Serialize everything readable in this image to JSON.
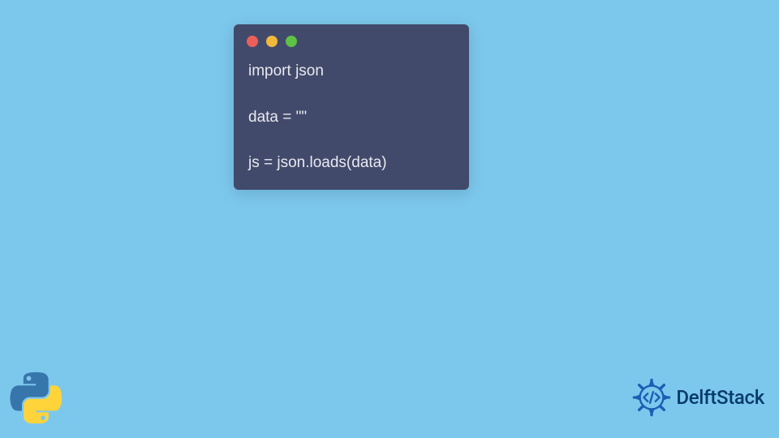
{
  "window": {
    "dots": {
      "red": "#ec5f59",
      "yellow": "#f1b93c",
      "green": "#5ec245"
    }
  },
  "code": {
    "lines": [
      "import json",
      "",
      "data = \"\"",
      "",
      "js = json.loads(data)"
    ]
  },
  "brand": {
    "name": "DelftStack"
  },
  "colors": {
    "background": "#7cc8ed",
    "window_bg": "#424a6b",
    "code_text": "#e8e9ef",
    "brand_text": "#083a6b",
    "python_blue": "#3776ab",
    "python_yellow": "#ffd43b",
    "delft_blue": "#1a5fb4"
  }
}
